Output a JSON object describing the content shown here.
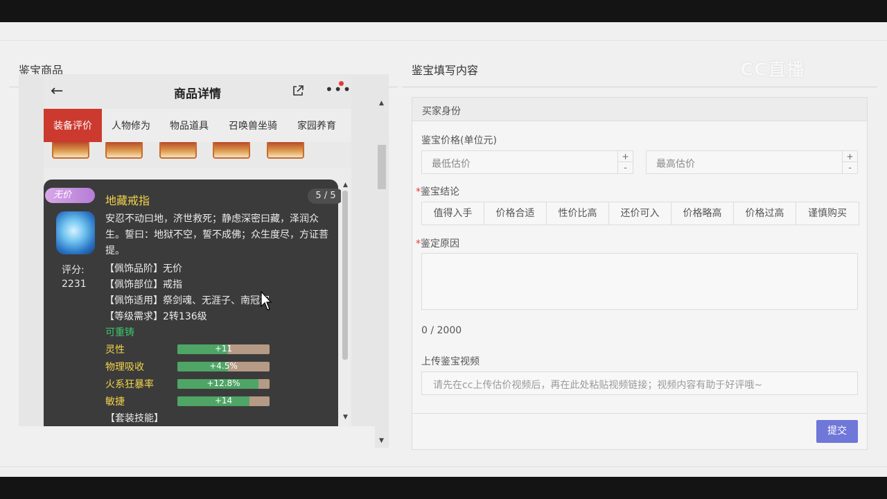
{
  "left_section": {
    "title": "鉴宝商品"
  },
  "right_section": {
    "title": "鉴宝填写内容"
  },
  "watermark": "CC直播",
  "phone": {
    "back_icon": "arrow-left-icon",
    "title": "商品详情",
    "share_icon": "share-icon",
    "more_icon": "more-dots-icon",
    "tabs": [
      {
        "label": "装备评价",
        "active": true
      },
      {
        "label": "人物修为",
        "active": false
      },
      {
        "label": "物品道具",
        "active": false
      },
      {
        "label": "召唤兽坐骑",
        "active": false
      },
      {
        "label": "家园养育",
        "active": false
      }
    ],
    "card": {
      "badge": "无价",
      "name": "地藏戒指",
      "page": "5 / 5",
      "description": "安忍不动曰地，济世救死；静虑深密曰藏，泽润众生。誓曰：地狱不空，誓不成佛；众生度尽，方证菩提。",
      "score_label": "评分:",
      "score_value": "2231",
      "props": [
        "【佩饰品阶】无价",
        "【佩饰部位】戒指",
        "【佩饰适用】祭剑魂、无涯子、南冠客",
        "【等级需求】2转136级"
      ],
      "recast": "可重铸",
      "stats": [
        {
          "label": "灵性",
          "value": "+11",
          "fill": 0.55
        },
        {
          "label": "物理吸收",
          "value": "+4.5%",
          "fill": 0.55
        },
        {
          "label": "火系狂暴率",
          "value": "+12.8%",
          "fill": 0.88
        },
        {
          "label": "敏捷",
          "value": "+14",
          "fill": 0.78
        }
      ],
      "set_skill": "【套装技能】"
    }
  },
  "form": {
    "buyer_identity": "买家身份",
    "price_label": "鉴宝价格(单位元)",
    "min_price_placeholder": "最低估价",
    "max_price_placeholder": "最高估价",
    "stepper_plus": "+",
    "stepper_minus": "-",
    "conclusion_label": "鉴宝结论",
    "required_mark": "*",
    "conclusions": [
      "值得入手",
      "价格合适",
      "性价比高",
      "还价可入",
      "价格略高",
      "价格过高",
      "谨慎购买"
    ],
    "reason_label": "鉴定原因",
    "reason_counter": "0 / 2000",
    "video_label": "上传鉴宝视频",
    "video_placeholder": "请先在cc上传估价视频后，再在此处粘贴视频链接；视频内容有助于好评哦~",
    "submit_label": "提交"
  }
}
